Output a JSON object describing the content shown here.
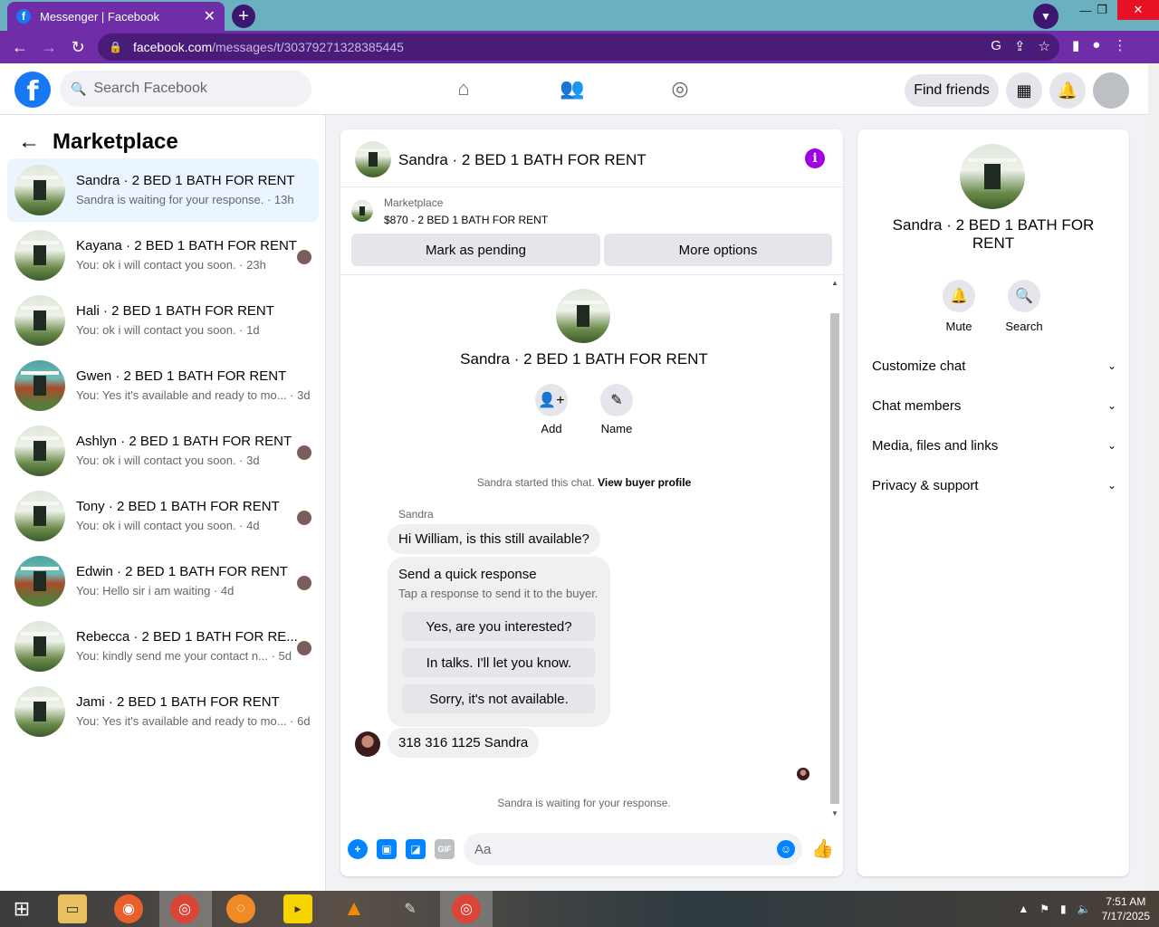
{
  "browser": {
    "tab_title": "Messenger | Facebook",
    "url_domain": "facebook.com",
    "url_path": "/messages/t/30379271328385445"
  },
  "fb": {
    "search_placeholder": "Search Facebook",
    "find_friends": "Find friends"
  },
  "left": {
    "title": "Marketplace",
    "conversations": [
      {
        "name": "Sandra · 2 BED 1 BATH FOR RENT",
        "preview": "Sandra is waiting for your response. · 13h",
        "teal": false
      },
      {
        "name": "Kayana · 2 BED 1 BATH FOR RENT",
        "preview": "You: ok i will contact you soon. · 23h",
        "teal": false
      },
      {
        "name": "Hali · 2 BED 1 BATH FOR RENT",
        "preview": "You: ok i will contact you soon. · 1d",
        "teal": false
      },
      {
        "name": "Gwen · 2 BED 1 BATH FOR RENT",
        "preview": "You: Yes it's available and ready to mo... · 3d",
        "teal": true
      },
      {
        "name": "Ashlyn · 2 BED 1 BATH FOR RENT",
        "preview": "You: ok i will contact you soon. · 3d",
        "teal": false
      },
      {
        "name": "Tony · 2 BED 1 BATH FOR RENT",
        "preview": "You: ok i will contact you soon. · 4d",
        "teal": false
      },
      {
        "name": "Edwin · 2 BED 1 BATH FOR RENT",
        "preview": "You: Hello sir i am waiting · 4d",
        "teal": true
      },
      {
        "name": "Rebecca · 2 BED 1 BATH FOR RE...",
        "preview": "You: kindly send me your contact n... · 5d",
        "teal": false
      },
      {
        "name": "Jami · 2 BED 1 BATH FOR RENT",
        "preview": "You: Yes it's available and ready to mo... · 6d",
        "teal": false
      }
    ]
  },
  "chat": {
    "title": "Sandra · 2 BED 1 BATH FOR RENT",
    "listing_label": "Marketplace",
    "listing_price": "$870 - 2 BED 1 BATH FOR RENT",
    "mark_pending": "Mark as pending",
    "more_options": "More options",
    "profile_name": "Sandra · 2 BED 1 BATH FOR RENT",
    "add_label": "Add",
    "name_label": "Name",
    "started_text": "Sandra started this chat.",
    "view_profile": "View buyer profile",
    "sender": "Sandra",
    "msg1": "Hi William, is this still available?",
    "qr_title": "Send a quick response",
    "qr_sub": "Tap a response to send it to the buyer.",
    "qr_options": [
      "Yes, are you interested?",
      "In talks. I'll let you know.",
      "Sorry, it's not available."
    ],
    "msg2": "318 316 1125 Sandra",
    "waiting": "Sandra is waiting for your response.",
    "composer_placeholder": "Aa"
  },
  "right": {
    "name": "Sandra · 2 BED 1 BATH FOR RENT",
    "mute": "Mute",
    "search": "Search",
    "sections": [
      "Customize chat",
      "Chat members",
      "Media, files and links",
      "Privacy & support"
    ]
  },
  "taskbar": {
    "time": "7:51 AM",
    "date": "7/17/2025"
  }
}
